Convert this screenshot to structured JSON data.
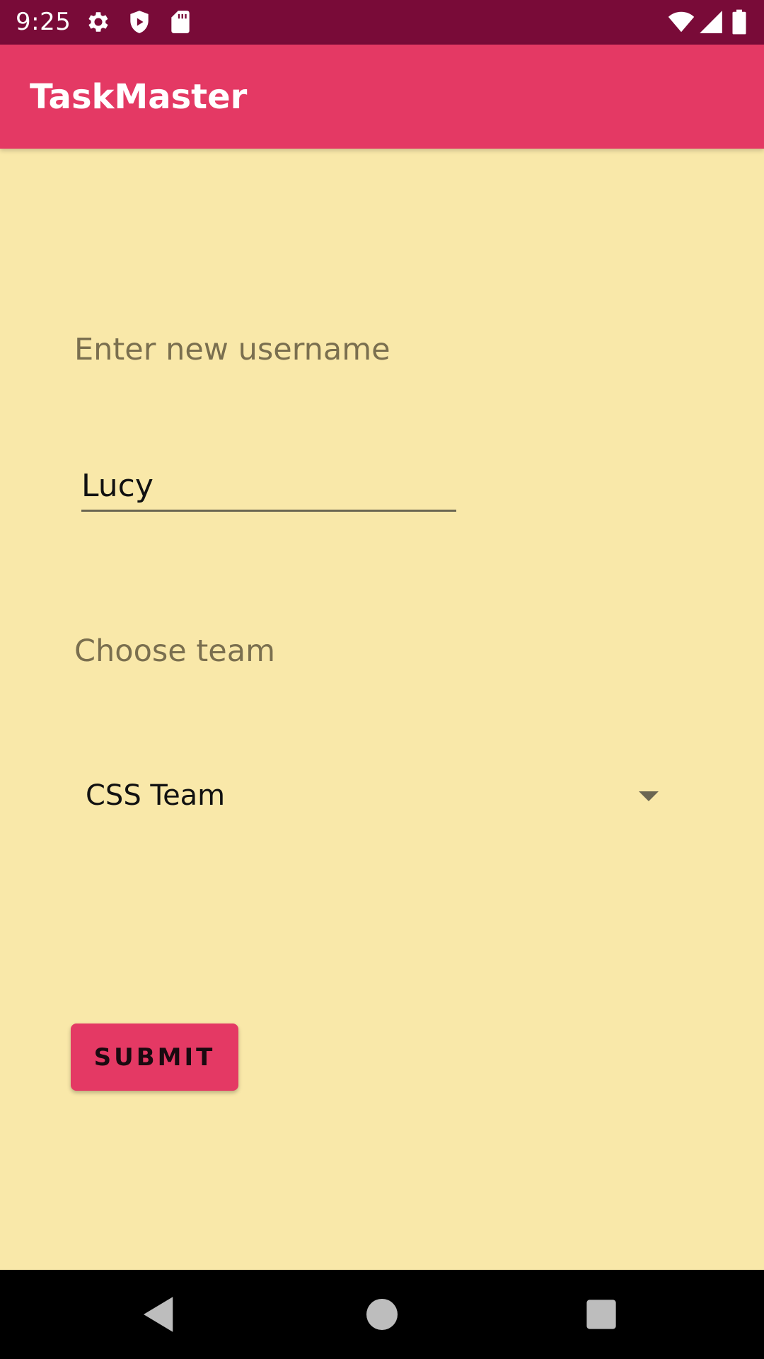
{
  "status_bar": {
    "time": "9:25",
    "icons": [
      "gear-icon",
      "shield-icon",
      "sd-card-icon",
      "wifi-icon",
      "signal-icon",
      "battery-icon"
    ],
    "background": "#790B38"
  },
  "app_bar": {
    "title": "TaskMaster",
    "background": "#E43964"
  },
  "form": {
    "username_label": "Enter new username",
    "username_value": "Lucy",
    "team_label": "Choose team",
    "team_selected": "CSS Team",
    "submit_label": "SUBMIT"
  },
  "nav_bar": {
    "buttons": [
      "back-icon",
      "home-icon",
      "recents-icon"
    ]
  },
  "colors": {
    "background": "#F9E8A9",
    "accent": "#E43964",
    "label_text": "#7A6F4F"
  }
}
